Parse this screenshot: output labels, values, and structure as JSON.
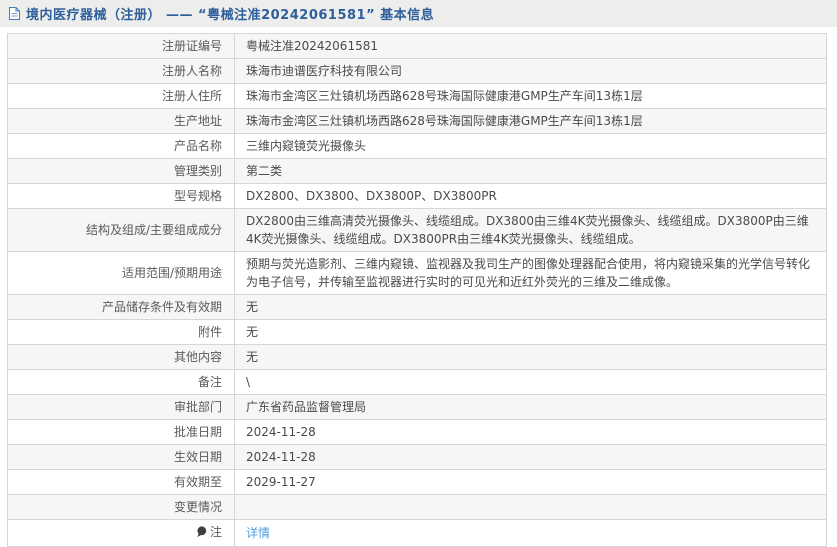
{
  "colors": {
    "title_text": "#2d5f9b",
    "titlebar_background": "#ededec",
    "link": "#4b9fe1",
    "row_stripe": "#f5f6f7",
    "table_border": "#c3c6c9"
  },
  "header": {
    "icon": "document-icon",
    "title": "境内医疗器械（注册） —— “粤械注准20242061581” 基本信息"
  },
  "table": {
    "rows": [
      {
        "label": "注册证编号",
        "value": "粤械注准20242061581"
      },
      {
        "label": "注册人名称",
        "value": "珠海市迪谱医疗科技有限公司"
      },
      {
        "label": "注册人住所",
        "value": "珠海市金湾区三灶镇机场西路628号珠海国际健康港GMP生产车间13栋1层"
      },
      {
        "label": "生产地址",
        "value": "珠海市金湾区三灶镇机场西路628号珠海国际健康港GMP生产车间13栋1层"
      },
      {
        "label": "产品名称",
        "value": "三维内窥镜荧光摄像头"
      },
      {
        "label": "管理类别",
        "value": "第二类"
      },
      {
        "label": "型号规格",
        "value": "DX2800、DX3800、DX3800P、DX3800PR"
      },
      {
        "label": "结构及组成/主要组成成分",
        "value": "DX2800由三维高清荧光摄像头、线缆组成。DX3800由三维4K荧光摄像头、线缆组成。DX3800P由三维4K荧光摄像头、线缆组成。DX3800PR由三维4K荧光摄像头、线缆组成。"
      },
      {
        "label": "适用范围/预期用途",
        "value": "预期与荧光造影剂、三维内窥镜、监视器及我司生产的图像处理器配合使用，将内窥镜采集的光学信号转化为电子信号，并传输至监视器进行实时的可见光和近红外荧光的三维及二维成像。"
      },
      {
        "label": "产品储存条件及有效期",
        "value": "无"
      },
      {
        "label": "附件",
        "value": "无"
      },
      {
        "label": "其他内容",
        "value": "无"
      },
      {
        "label": "备注",
        "value": "\\"
      },
      {
        "label": "审批部门",
        "value": "广东省药品监督管理局"
      },
      {
        "label": "批准日期",
        "value": "2024-11-28"
      },
      {
        "label": "生效日期",
        "value": "2024-11-28"
      },
      {
        "label": "有效期至",
        "value": "2029-11-27"
      },
      {
        "label": "变更情况",
        "value": ""
      },
      {
        "label": "注",
        "icon": "comment-icon",
        "link": "详情"
      }
    ]
  }
}
